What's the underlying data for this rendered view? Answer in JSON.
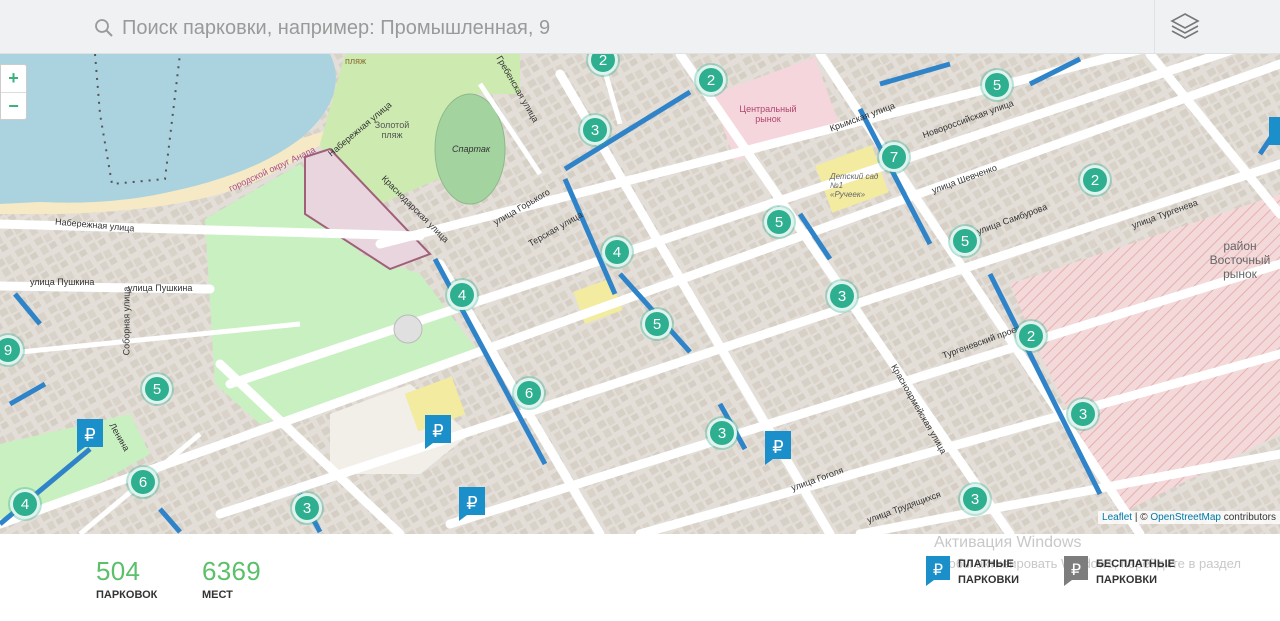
{
  "search": {
    "placeholder": "Поиск парковки, например: Промышленная, 9"
  },
  "icons": {
    "search": "search-icon",
    "layers": "layers-icon"
  },
  "zoom": {
    "in": "+",
    "out": "−"
  },
  "map": {
    "labels": [
      {
        "text": "Набережная улица"
      },
      {
        "text": "Набережная улица"
      },
      {
        "text": "Золотой пляж"
      },
      {
        "text": "Спартак"
      },
      {
        "text": "Гребенская улица"
      },
      {
        "text": "Центральный рынок"
      },
      {
        "text": "Крымская улица"
      },
      {
        "text": "Новороссийская улица"
      },
      {
        "text": "улица Шевченко"
      },
      {
        "text": "улица Самбурова"
      },
      {
        "text": "улица Тургенева"
      },
      {
        "text": "район Восточный рынок"
      },
      {
        "text": "Детский сад №1 «Ручеек»"
      },
      {
        "text": "Терская улица"
      },
      {
        "text": "улица Горького"
      },
      {
        "text": "Краснодарская улица"
      },
      {
        "text": "улица Пушкина"
      },
      {
        "text": "улица Пушкина"
      },
      {
        "text": "Соборная улица"
      },
      {
        "text": "Тургеневский проезд"
      },
      {
        "text": "Красноармейская улица"
      },
      {
        "text": "улица Гоголя"
      },
      {
        "text": "улица Трудящихся"
      },
      {
        "text": "Ленина"
      },
      {
        "text": "пляж"
      },
      {
        "text": "городской округ Анапа"
      }
    ],
    "clusters": [
      "2",
      "2",
      "5",
      "3",
      "7",
      "2",
      "5",
      "5",
      "4",
      "4",
      "3",
      "5",
      "2",
      "9",
      "5",
      "6",
      "3",
      "3",
      "3",
      "6",
      "4",
      "3"
    ],
    "parking_markers": 5,
    "attribution": {
      "leaflet": "Leaflet",
      "sep": " | © ",
      "osm": "OpenStreetMap",
      "tail": " contributors"
    }
  },
  "stats": [
    {
      "value": "504",
      "label": "ПАРКОВОК"
    },
    {
      "value": "6369",
      "label": "МЕСТ"
    }
  ],
  "legend": [
    {
      "symbol": "₽",
      "label_line1": "ПЛАТНЫЕ",
      "label_line2": "ПАРКОВКИ",
      "color": "#1a8fc9"
    },
    {
      "symbol": "₽",
      "label_line1": "БЕСПЛАТНЫЕ",
      "label_line2": "ПАРКОВКИ",
      "color": "#7d7d7d"
    }
  ],
  "watermark": {
    "line1": "Активация Windows",
    "line2": "Чтобы активировать Windows, перейдите в раздел"
  },
  "colors": {
    "cluster": "#2eaf8f",
    "paid": "#1a8fc9",
    "free": "#7d7d7d",
    "street_paid": "#2f83c9",
    "stat_number": "#5cc06a"
  }
}
